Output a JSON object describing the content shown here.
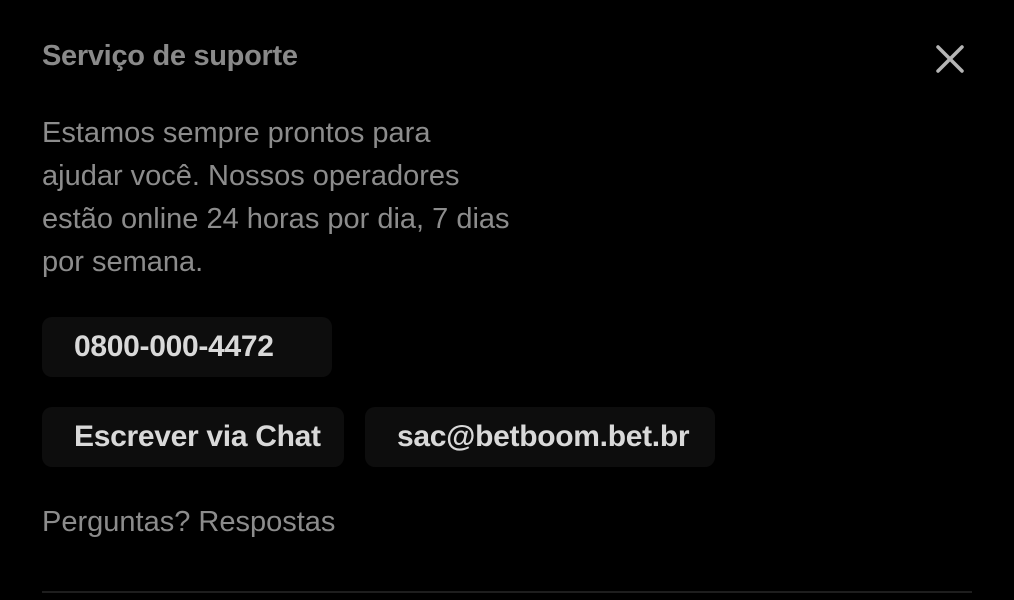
{
  "dialog": {
    "title": "Serviço de suporte",
    "close_icon": "close-icon",
    "description": "Estamos sempre prontos para ajudar você. Nossos operadores estão online 24 horas por dia, 7 dias por semana.",
    "phone_label": "0800-000-4472",
    "chat_label": "Escrever via Chat",
    "email_label": "sac@betboom.bet.br",
    "faq_label": "Perguntas? Respostas"
  },
  "colors": {
    "background": "#000000",
    "button_background": "#0d0d0d",
    "button_text": "#d9d9d9",
    "muted_text": "#8c8c8c"
  }
}
